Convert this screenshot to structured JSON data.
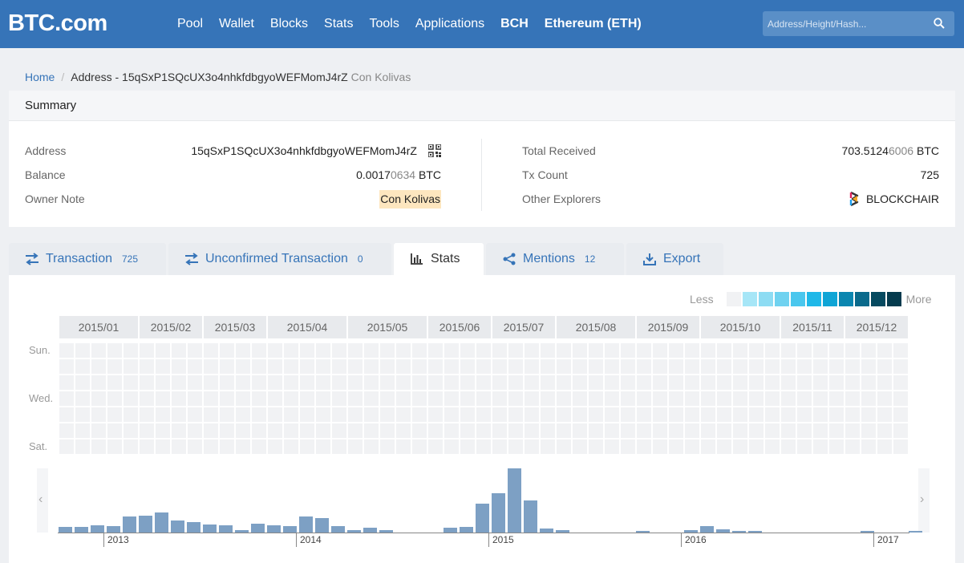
{
  "header": {
    "logo": "BTC.com",
    "nav": [
      {
        "label": "Pool",
        "bold": false
      },
      {
        "label": "Wallet",
        "bold": false
      },
      {
        "label": "Blocks",
        "bold": false
      },
      {
        "label": "Stats",
        "bold": false
      },
      {
        "label": "Tools",
        "bold": false
      },
      {
        "label": "Applications",
        "bold": false
      },
      {
        "label": "BCH",
        "bold": true
      },
      {
        "label": "Ethereum (ETH)",
        "bold": true
      }
    ],
    "search_placeholder": "Address/Height/Hash..."
  },
  "breadcrumb": {
    "home": "Home",
    "current": "Address - 15qSxP1SQcUX3o4nhkfdbgyoWEFMomJ4rZ",
    "note": "Con Kolivas"
  },
  "summary": {
    "title": "Summary",
    "address_label": "Address",
    "address": "15qSxP1SQcUX3o4nhkfdbgyoWEFMomJ4rZ",
    "balance_label": "Balance",
    "balance_main": "0.0017",
    "balance_dim": "0634",
    "balance_unit": "BTC",
    "owner_label": "Owner Note",
    "owner": "Con Kolivas",
    "received_label": "Total Received",
    "received_main": "703.5124",
    "received_dim": "6006",
    "received_unit": "BTC",
    "txcount_label": "Tx Count",
    "txcount": "725",
    "explorers_label": "Other Explorers",
    "explorer": "BLOCKCHAIR"
  },
  "tabs": [
    {
      "label": "Transaction",
      "count": "725",
      "icon": "transfer-icon",
      "active": false
    },
    {
      "label": "Unconfirmed Transaction",
      "count": "0",
      "icon": "transfer-icon",
      "active": false
    },
    {
      "label": "Stats",
      "count": "",
      "icon": "bar-chart-icon",
      "active": true
    },
    {
      "label": "Mentions",
      "count": "12",
      "icon": "share-icon",
      "active": false
    },
    {
      "label": "Export",
      "count": "",
      "icon": "download-icon",
      "active": false
    }
  ],
  "heatmap": {
    "legend_less": "Less",
    "legend_more": "More",
    "legend_colors": [
      "#f1f2f4",
      "#a6e6f7",
      "#8ddcf3",
      "#6fd2f0",
      "#4ac7ee",
      "#1fb8e8",
      "#0ea5d6",
      "#0b86b0",
      "#0a6a8c",
      "#064a60",
      "#053b4e"
    ],
    "months": [
      "2015/01",
      "2015/02",
      "2015/03",
      "2015/04",
      "2015/05",
      "2015/06",
      "2015/07",
      "2015/08",
      "2015/09",
      "2015/10",
      "2015/11",
      "2015/12"
    ],
    "month_weeks": [
      5,
      4,
      4,
      5,
      5,
      4,
      4,
      5,
      4,
      5,
      4,
      4
    ],
    "day_labels": [
      "Sun.",
      "Wed.",
      "Sat."
    ]
  },
  "timeline": {
    "prev": "‹",
    "next": "›",
    "year_labels": [
      "2013",
      "2014",
      "2015",
      "2016",
      "2017"
    ],
    "bar_values": [
      8,
      8,
      10,
      9,
      22,
      24,
      28,
      17,
      15,
      11,
      10,
      3,
      12,
      10,
      9,
      23,
      20,
      9,
      3,
      7,
      3,
      0,
      0,
      0,
      7,
      8,
      40,
      55,
      90,
      45,
      6,
      3,
      0,
      0,
      0,
      0,
      2,
      0,
      0,
      3,
      9,
      4,
      2,
      2,
      0,
      0,
      0,
      0,
      0,
      0,
      2,
      0,
      0,
      2,
      0,
      0,
      0,
      0,
      0,
      0,
      0,
      0,
      0,
      0,
      0,
      0,
      0,
      0,
      0,
      0,
      0,
      0
    ],
    "bar_max": 90
  }
}
